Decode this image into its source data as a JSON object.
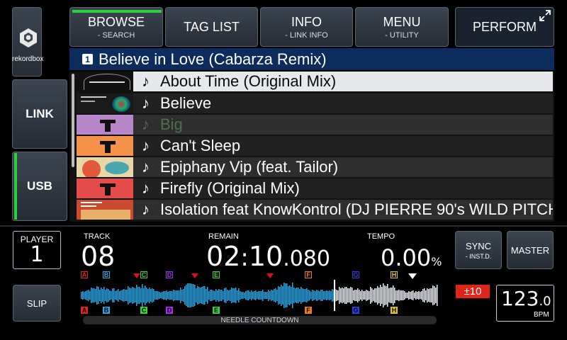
{
  "sidebar": {
    "logo_label": "rekordbox",
    "link_label": "LINK",
    "usb_label": "USB"
  },
  "tabs": [
    {
      "label": "BROWSE",
      "sub": "- SEARCH"
    },
    {
      "label": "TAG LIST",
      "sub": ""
    },
    {
      "label": "INFO",
      "sub": "- LINK INFO"
    },
    {
      "label": "MENU",
      "sub": "- UTILITY"
    },
    {
      "label": "PERFORM",
      "sub": ""
    }
  ],
  "browser": {
    "deck_number": "1",
    "title": "Believe in Love (Cabarza Remix)",
    "tracks": [
      {
        "name": "About Time (Original Mix)"
      },
      {
        "name": "Believe"
      },
      {
        "name": "Big"
      },
      {
        "name": "Can't Sleep"
      },
      {
        "name": "Epiphany Vip (feat. Tailor)"
      },
      {
        "name": "Firefly (Original Mix)"
      },
      {
        "name": "Isolation feat KnowKontrol (DJ PIERRE 90's WILD PITCH"
      }
    ]
  },
  "player": {
    "label": "PLAYER",
    "number": "1",
    "slip_label": "SLIP"
  },
  "readouts": {
    "track_label": "TRACK",
    "track_value": "08",
    "remain_label": "REMAIN",
    "remain_min": "02",
    "remain_sep": ":",
    "remain_sec": "10",
    "remain_ms": ".080",
    "tempo_label": "TEMPO",
    "tempo_value": "0.00",
    "tempo_unit": "%",
    "tempo_range": "±10",
    "bpm_int": "123",
    "bpm_dec": ".0",
    "bpm_label": "BPM"
  },
  "buttons": {
    "sync_label": "SYNC",
    "sync_sub": "- INST.D.",
    "master_label": "MASTER"
  },
  "waveform": {
    "needle_label": "NEEDLE COUNTDOWN",
    "progress": 0.71,
    "hotcues": [
      {
        "letter": "A",
        "color": "#e2241f",
        "pos": 0.0
      },
      {
        "letter": "B",
        "color": "#27a7e6",
        "pos": 0.064
      },
      {
        "letter": "C",
        "color": "#3bd23b",
        "pos": 0.17
      },
      {
        "letter": "D",
        "color": "#a42ef0",
        "pos": 0.244
      },
      {
        "letter": "E",
        "color": "#3bd23b",
        "pos": 0.378
      },
      {
        "letter": "F",
        "color": "#f07c15",
        "pos": 0.642
      },
      {
        "letter": "G",
        "color": "#2f3fe0",
        "pos": 0.778
      },
      {
        "letter": "H",
        "color": "#e6c814",
        "pos": 0.889
      }
    ],
    "memory_points": [
      0.146,
      0.31,
      0.52
    ],
    "accent_colors": {
      "wave": "#2aa6e6",
      "cue_marker": "#d11",
      "active_tab": "#2bd13a"
    }
  }
}
